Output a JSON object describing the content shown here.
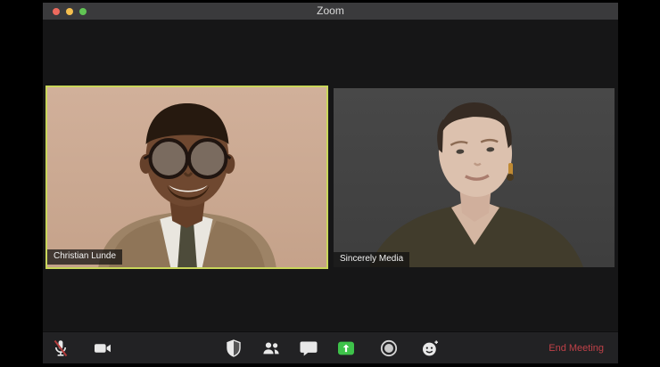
{
  "window": {
    "title": "Zoom",
    "titlebar_buttons": [
      {
        "name": "close-window-button",
        "color": "#ed6a5e"
      },
      {
        "name": "minimize-window-button",
        "color": "#f4bf4f"
      },
      {
        "name": "zoom-window-button",
        "color": "#61c554"
      }
    ]
  },
  "participants": [
    {
      "name": "Christian Lunde",
      "active_speaker": true,
      "border_color": "#c9d65b"
    },
    {
      "name": "Sincerely Media",
      "active_speaker": false,
      "border_color": null
    }
  ],
  "toolbar": {
    "items": [
      {
        "icon": "microphone-muted-icon",
        "state": "muted"
      },
      {
        "icon": "video-camera-icon",
        "state": "on"
      },
      {
        "icon": "security-shield-icon"
      },
      {
        "icon": "participants-icon"
      },
      {
        "icon": "chat-bubble-icon"
      },
      {
        "icon": "share-screen-icon",
        "accent_color": "#3ec24a"
      },
      {
        "icon": "record-icon"
      },
      {
        "icon": "reactions-smiley-icon"
      }
    ],
    "end_meeting_label": "End Meeting",
    "end_meeting_color": "#bf4148"
  }
}
